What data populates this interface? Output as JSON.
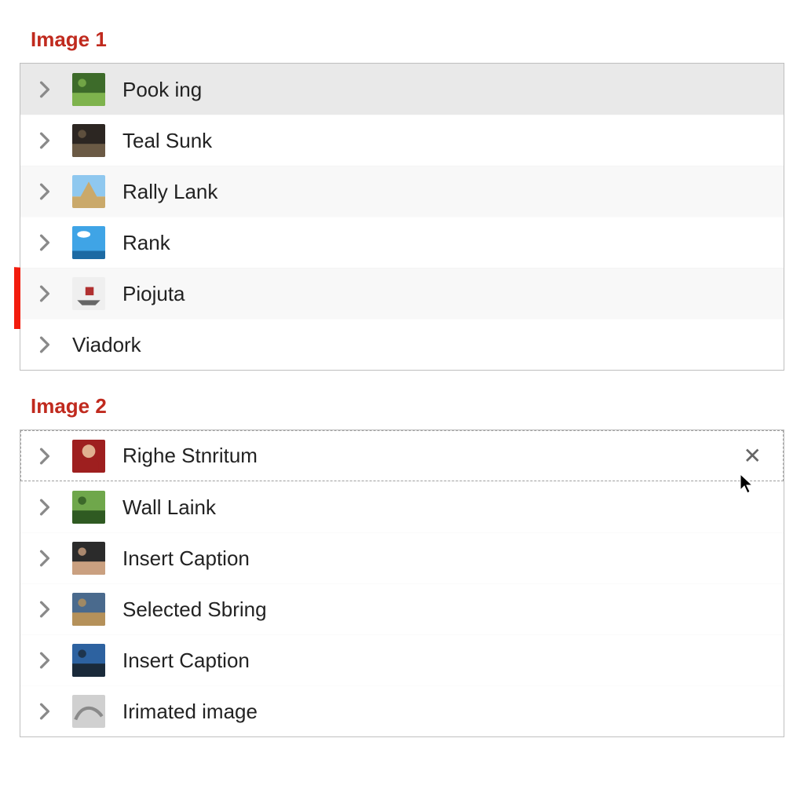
{
  "image1": {
    "heading": "Image 1",
    "rows": [
      {
        "label": "Pook ing",
        "thumb": "landscape-green",
        "selected": true,
        "alt": false,
        "chevron": true
      },
      {
        "label": "Teal Sunk",
        "thumb": "cactus-dark",
        "selected": false,
        "alt": false,
        "chevron": true
      },
      {
        "label": "Rally Lank",
        "thumb": "pyramid-sky",
        "selected": false,
        "alt": true,
        "chevron": true
      },
      {
        "label": "Rank",
        "thumb": "beach-sky",
        "selected": false,
        "alt": false,
        "chevron": true
      },
      {
        "label": "Piojuta",
        "thumb": "boat-white",
        "selected": false,
        "alt": true,
        "chevron": true,
        "arrow": true
      },
      {
        "label": "Viadork",
        "thumb": "none",
        "selected": false,
        "alt": false,
        "chevron": true
      }
    ]
  },
  "image2": {
    "heading": "Image 2",
    "rows": [
      {
        "label": "Righe Stnritum",
        "thumb": "person-red",
        "chevron": true,
        "dashed": true,
        "closeable": true,
        "cursor": true
      },
      {
        "label": "Wall Laink",
        "thumb": "tree-grass",
        "chevron": true
      },
      {
        "label": "Insert Caption",
        "thumb": "people-dark",
        "chevron": true
      },
      {
        "label": "Selected Sbring",
        "thumb": "vehicle",
        "chevron": true
      },
      {
        "label": "Insert Caption",
        "thumb": "climb-blue",
        "chevron": true
      },
      {
        "label": "Irimated image",
        "thumb": "gray-sketch",
        "chevron": true
      }
    ]
  },
  "thumb_defs": {
    "landscape-green": {
      "bg": "#3d6b2a",
      "accent": "#7eb34d"
    },
    "cactus-dark": {
      "bg": "#2c2622",
      "accent": "#6b5a45"
    },
    "pyramid-sky": {
      "bg": "#8fc8ef",
      "accent": "#caa96a"
    },
    "beach-sky": {
      "bg": "#3fa4e6",
      "accent": "#ffffff"
    },
    "boat-white": {
      "bg": "#efefef",
      "accent": "#b03030"
    },
    "person-red": {
      "bg": "#9e1f1f",
      "accent": "#e0b090"
    },
    "tree-grass": {
      "bg": "#6fa74b",
      "accent": "#2f5a22"
    },
    "people-dark": {
      "bg": "#2b2b2b",
      "accent": "#caa080"
    },
    "vehicle": {
      "bg": "#4a6a8d",
      "accent": "#b5915a"
    },
    "climb-blue": {
      "bg": "#2d62a0",
      "accent": "#1a2a3a"
    },
    "gray-sketch": {
      "bg": "#d0d0d0",
      "accent": "#8a8a8a"
    },
    "none": {
      "bg": "#ffffff",
      "accent": "#ffffff"
    }
  },
  "colors": {
    "heading": "#C02A1E",
    "arrow": "#F21C0D"
  }
}
